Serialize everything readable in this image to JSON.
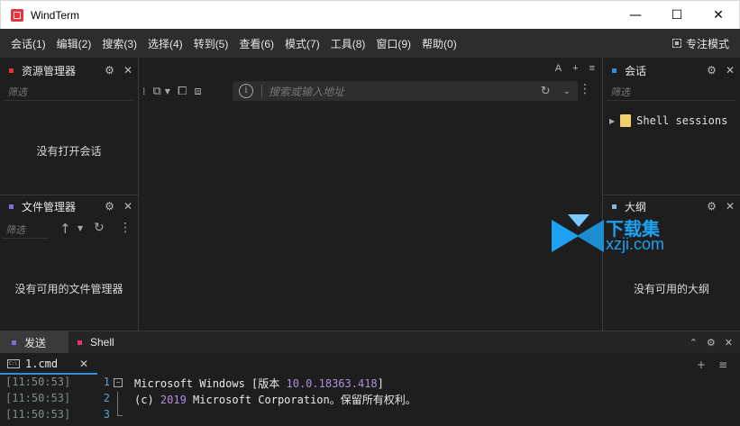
{
  "window": {
    "title": "WindTerm",
    "minimize": "—",
    "maximize": "☐",
    "close": "✕"
  },
  "menu": {
    "items": [
      "会话(1)",
      "编辑(2)",
      "搜索(3)",
      "选择(4)",
      "转到(5)",
      "查看(6)",
      "模式(7)",
      "工具(8)",
      "窗口(9)",
      "帮助(0)"
    ],
    "focus_mode": "专注模式"
  },
  "left_top_panel": {
    "title": "资源管理器",
    "filter_placeholder": "筛选",
    "empty": "没有打开会话",
    "dot_color": "#e8323c"
  },
  "left_bottom_panel": {
    "title": "文件管理器",
    "filter_placeholder": "筛选",
    "empty": "没有可用的文件管理器",
    "dot_color": "#7a6fd6"
  },
  "right_top_panel": {
    "title": "会话",
    "filter_placeholder": "筛选",
    "tree_item": "Shell sessions",
    "dot_color": "#2f8fd8"
  },
  "right_bottom_panel": {
    "title": "大纲",
    "empty": "没有可用的大纲",
    "dot_color": "#7fb8e8"
  },
  "center": {
    "address_placeholder": "搜索或输入地址",
    "font_tool": "A",
    "add_tool": "+",
    "menu_tool": "≡"
  },
  "watermark": {
    "title": "下载集",
    "url": "xzji.com"
  },
  "bottom": {
    "tabs": [
      {
        "label": "发送",
        "dot_color": "#7a6fd6"
      },
      {
        "label": "Shell",
        "dot_color": "#e8326e"
      }
    ],
    "session_tab": {
      "label": "1.cmd",
      "icon_text": "C:\\"
    }
  },
  "terminal": {
    "lines": [
      {
        "time": "[11:50:53]",
        "num": "1",
        "text_a": "Microsoft Windows [版本 ",
        "version": "10.0.18363.418",
        "text_b": "]"
      },
      {
        "time": "[11:50:53]",
        "num": "2",
        "text_a": "(c) ",
        "year": "2019",
        "text_b": " Microsoft Corporation。保留所有权利。"
      },
      {
        "time": "[11:50:53]",
        "num": "3"
      }
    ]
  }
}
